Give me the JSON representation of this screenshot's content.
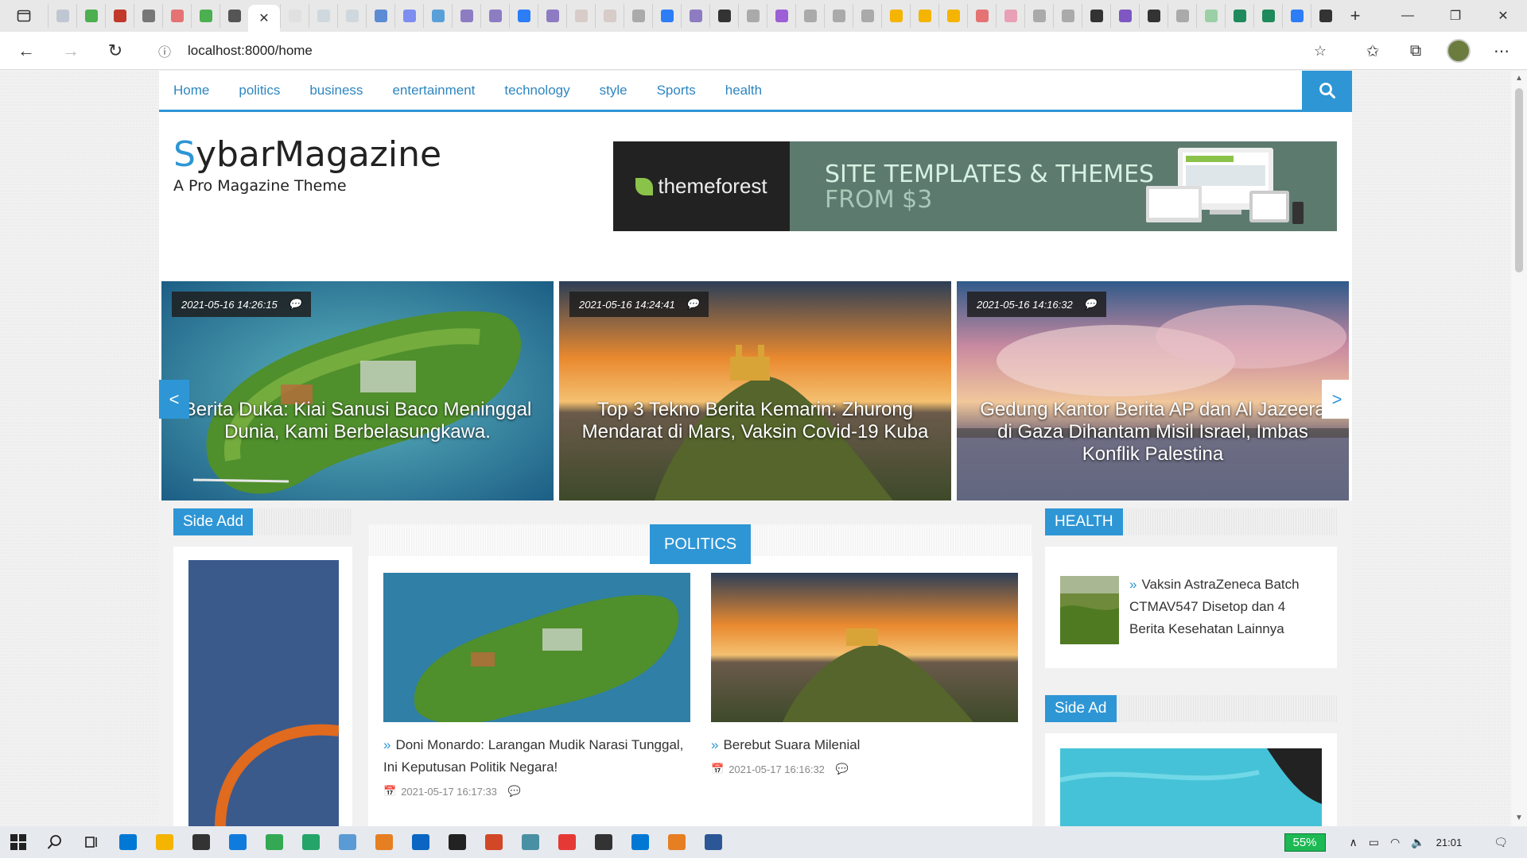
{
  "browser": {
    "url": "localhost:8000/home",
    "tab_favicon_colors": [
      "#bfc7d3",
      "#4caf50",
      "#c0392b",
      "#777",
      "#e57373",
      "#4caf50",
      "#555",
      "#e0e0e0",
      "#cfd8dc",
      "#cfd8dc",
      "#5c8bd6",
      "#7e8ef0",
      "#5aa0d8",
      "#8e7cc3",
      "#8e7cc3",
      "#2d7df6",
      "#8e7cc3",
      "#d7ccc8",
      "#d7ccc8",
      "#aaa",
      "#2d7df6",
      "#8e7cc3",
      "#333",
      "#aaa",
      "#9c5fd6",
      "#aaa",
      "#aaa",
      "#aaa",
      "#f4b400",
      "#f4b400",
      "#f4b400",
      "#e57373",
      "#e8a0b6",
      "#aaa",
      "#aaa",
      "#333",
      "#7e57c2",
      "#333",
      "#aaa",
      "#9bd0a6",
      "#1f8a5b",
      "#1f8a5b",
      "#2d7df6",
      "#333"
    ]
  },
  "site": {
    "nav": [
      "Home",
      "politics",
      "business",
      "entertainment",
      "technology",
      "style",
      "Sports",
      "health"
    ],
    "logo_first": "S",
    "logo_rest": "ybarMagazine",
    "tagline": "A Pro Magazine Theme",
    "banner": {
      "brand": "themeforest",
      "line1": "SITE TEMPLATES & THEMES",
      "line2": "FROM $3"
    }
  },
  "slider": [
    {
      "date": "2021-05-16 14:26:15",
      "title": "Berita Duka: Kiai Sanusi Baco Meninggal Dunia, Kami Berbelasungkawa."
    },
    {
      "date": "2021-05-16 14:24:41",
      "title": "Top 3 Tekno Berita Kemarin: Zhurong Mendarat di Mars, Vaksin Covid-19 Kuba"
    },
    {
      "date": "2021-05-16 14:16:32",
      "title": "Gedung Kantor Berita AP dan Al Jazeera di Gaza Dihantam Misil Israel, Imbas Konflik Palestina"
    }
  ],
  "slider_prev": "<",
  "slider_next": ">",
  "sidebar_left": {
    "title": "Side Add"
  },
  "politics": {
    "title": "POLITICS",
    "posts": [
      {
        "title": "Doni Monardo: Larangan Mudik Narasi Tunggal, Ini Keputusan Politik Negara!",
        "date": "2021-05-17 16:17:33"
      },
      {
        "title": "Berebut Suara Milenial",
        "date": "2021-05-17 16:16:32"
      }
    ]
  },
  "health": {
    "title": "HEALTH",
    "posts": [
      {
        "title": "Vaksin AstraZeneca Batch CTMAV547 Disetop dan 4 Berita Kesehatan Lainnya"
      }
    ]
  },
  "sidebar_right": {
    "title": "Side Ad"
  },
  "taskbar": {
    "battery": "55%",
    "time": "21:01",
    "app_colors": [
      "#0078d4",
      "#f4b400",
      "#333",
      "#0f7bdc",
      "#34a853",
      "#25a46a",
      "#5b9bd5",
      "#e67e22",
      "#0a66c2",
      "#222",
      "#d24726",
      "#4a90a4",
      "#e53935",
      "#333",
      "#0078d4",
      "#e67e22",
      "#2b5797"
    ]
  }
}
